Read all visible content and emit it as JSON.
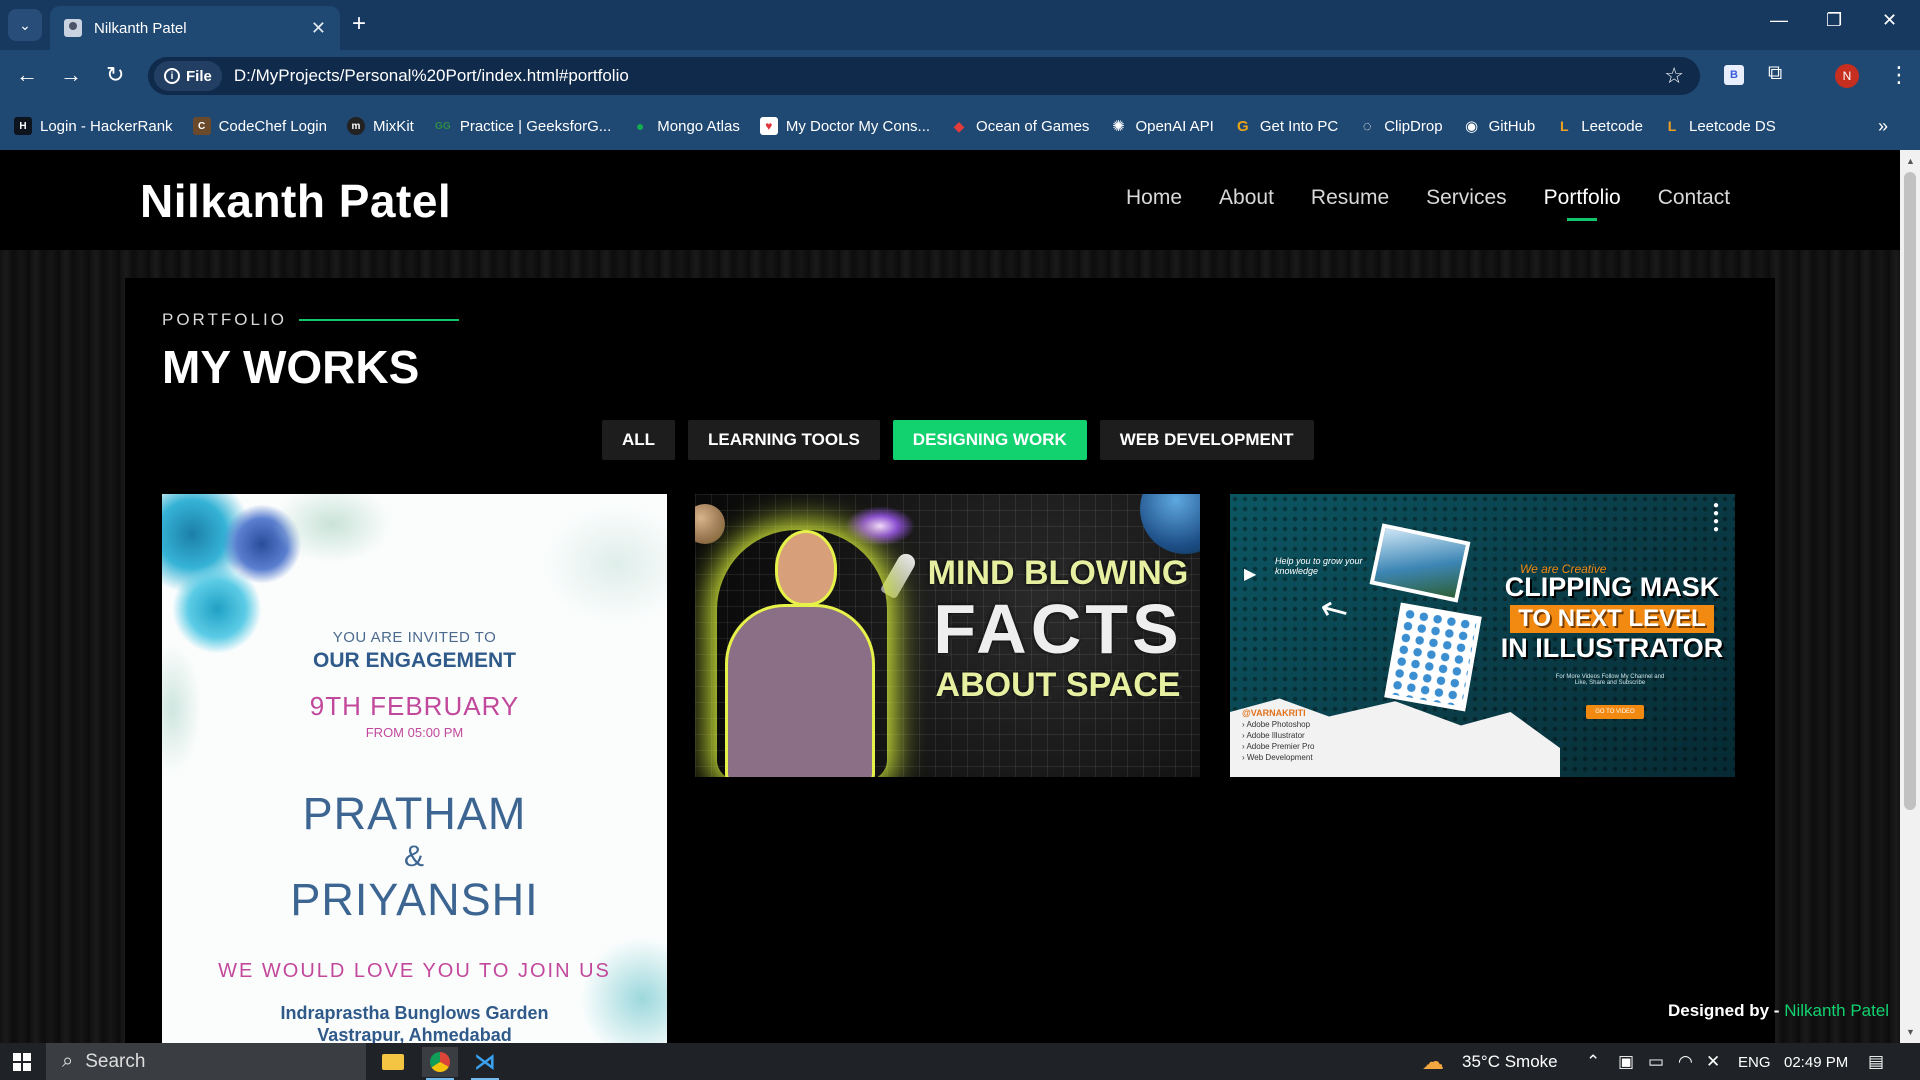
{
  "browser": {
    "tab_title": "Nilkanth Patel",
    "url": "D:/MyProjects/Personal%20Port/index.html#portfolio",
    "site_chip_label": "File",
    "profile_initial": "N",
    "extension_letter": "B",
    "bookmarks": [
      {
        "label": "Login - HackerRank",
        "color": "#0e141e",
        "glyph": "H"
      },
      {
        "label": "CodeChef Login",
        "color": "#6b4a2c",
        "glyph": "C"
      },
      {
        "label": "MixKit",
        "color": "#222222",
        "glyph": "m"
      },
      {
        "label": "Practice | GeeksforG...",
        "color": "#2f8d46",
        "glyph": "G"
      },
      {
        "label": "Mongo Atlas",
        "color": "#13aa52",
        "glyph": "●"
      },
      {
        "label": "My Doctor My Cons...",
        "color": "#e0333a",
        "glyph": "♥"
      },
      {
        "label": "Ocean of Games",
        "color": "#c0392b",
        "glyph": "◆"
      },
      {
        "label": "OpenAI API",
        "color": "#3a3a3a",
        "glyph": "✺"
      },
      {
        "label": "Get Into PC",
        "color": "#e8a317",
        "glyph": "G"
      },
      {
        "label": "ClipDrop",
        "color": "#2b2b2b",
        "glyph": "◌"
      },
      {
        "label": "GitHub",
        "color": "#24292e",
        "glyph": "◉"
      },
      {
        "label": "Leetcode",
        "color": "#3a3a3a",
        "glyph": "L"
      },
      {
        "label": "Leetcode DS",
        "color": "#3a3a3a",
        "glyph": "L"
      }
    ]
  },
  "site": {
    "logo": "Nilkanth Patel",
    "nav": [
      "Home",
      "About",
      "Resume",
      "Services",
      "Portfolio",
      "Contact"
    ],
    "active_nav": "Portfolio",
    "accent": "#12d16f"
  },
  "portfolio": {
    "eyebrow": "PORTFOLIO",
    "title": "MY WORKS",
    "filters": [
      "ALL",
      "LEARNING TOOLS",
      "DESIGNING WORK",
      "WEB DEVELOPMENT"
    ],
    "active_filter": "DESIGNING WORK",
    "invite": {
      "line1": "YOU ARE INVITED TO",
      "line2": "OUR ENGAGEMENT",
      "date": "9TH FEBRUARY",
      "from": "FROM 05:00 PM",
      "name1": "PRATHAM",
      "amp": "&",
      "name2": "PRIYANSHI",
      "join": "WE WOULD LOVE YOU TO JOIN US",
      "venue1": "Indraprastha Bunglows Garden",
      "venue2": "Vastrapur, Ahmedabad"
    },
    "space": {
      "line1": "MIND BLOWING",
      "line2": "FACTS",
      "line3": "ABOUT SPACE"
    },
    "clip": {
      "line1": "CLIPPING MASK",
      "line2": "TO NEXT LEVEL",
      "line3": "IN ILLUSTRATOR",
      "handwritten": "Help you to grow your knowledge",
      "tagline": "We are Creative",
      "brand": "@VARNAKRITI",
      "list": [
        "Adobe Photoshop",
        "Adobe Illustrator",
        "Adobe Premier Pro",
        "Web Development"
      ],
      "button": "GO TO VIDEO",
      "small_text": "For More Videos Follow My Channel and Like, Share and Subscribe"
    },
    "designed_by_label": "Designed by - ",
    "designed_by_name": "Nilkanth Patel"
  },
  "taskbar": {
    "search_placeholder": "Search",
    "weather": "35°C  Smoke",
    "language": "ENG",
    "time": "02:49 PM"
  }
}
